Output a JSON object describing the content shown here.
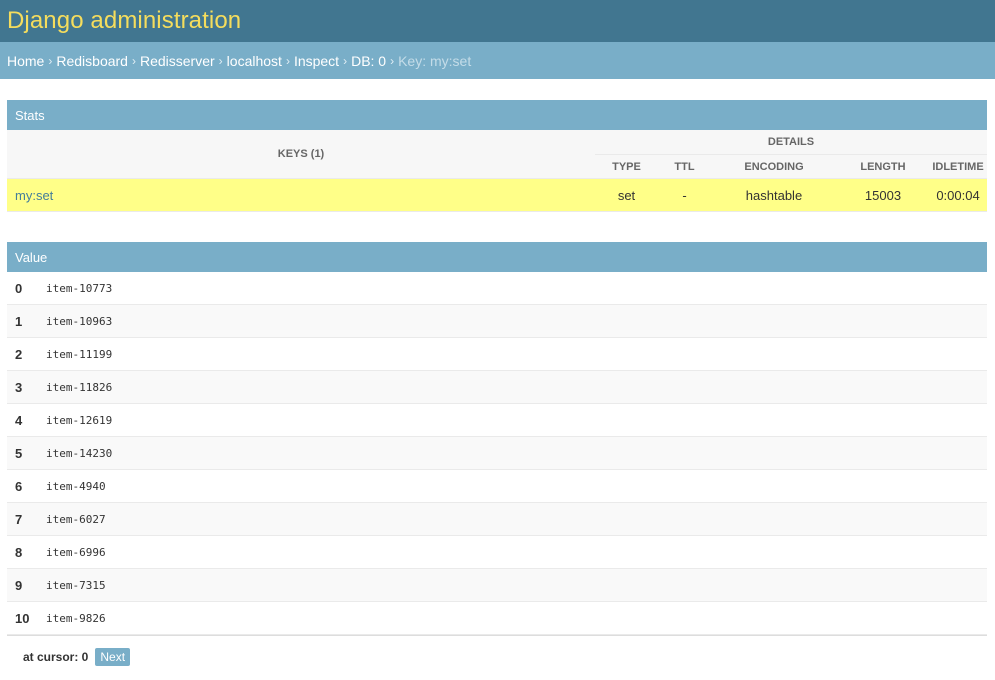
{
  "header": {
    "site_name": "Django administration"
  },
  "breadcrumbs": {
    "items": [
      "Home",
      "Redisboard",
      "Redisserver",
      "localhost",
      "Inspect",
      "DB: 0"
    ],
    "separator": "›",
    "current": "Key: my:set"
  },
  "stats": {
    "caption": "Stats",
    "keys_header": "KEYS (1)",
    "details_header": "DETAILS",
    "columns": [
      "TYPE",
      "TTL",
      "ENCODING",
      "LENGTH",
      "IDLETIME"
    ],
    "row": {
      "key": "my:set",
      "type": "set",
      "ttl": "-",
      "encoding": "hashtable",
      "length": "15003",
      "idletime": "0:00:04"
    }
  },
  "value": {
    "caption": "Value",
    "rows": [
      {
        "index": "0",
        "value": "item-10773"
      },
      {
        "index": "1",
        "value": "item-10963"
      },
      {
        "index": "2",
        "value": "item-11199"
      },
      {
        "index": "3",
        "value": "item-11826"
      },
      {
        "index": "4",
        "value": "item-12619"
      },
      {
        "index": "5",
        "value": "item-14230"
      },
      {
        "index": "6",
        "value": "item-4940"
      },
      {
        "index": "7",
        "value": "item-6027"
      },
      {
        "index": "8",
        "value": "item-6996"
      },
      {
        "index": "9",
        "value": "item-7315"
      },
      {
        "index": "10",
        "value": "item-9826"
      }
    ]
  },
  "pager": {
    "cursor_label": "at cursor: 0",
    "next_label": "Next"
  },
  "colors": {
    "header_bg": "#417690",
    "site_name": "#f5dd5d",
    "breadcrumbs_bg": "#79aec8",
    "caption_bg": "#79aec8",
    "highlight_row": "#ffff88",
    "link": "#447e9b"
  }
}
